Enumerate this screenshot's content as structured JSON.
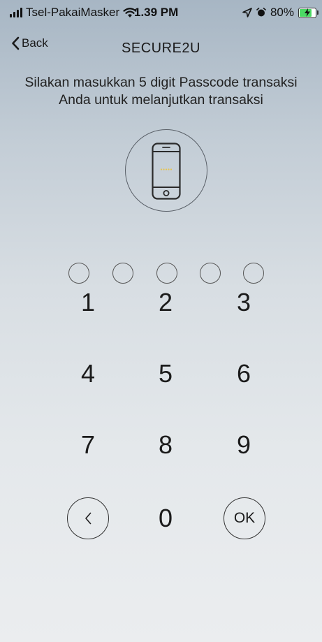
{
  "status_bar": {
    "carrier": "Tsel-PakaiMasker",
    "time": "1.39 PM",
    "battery": "80%",
    "battery_level": 0.8,
    "icons": [
      "signal-icon",
      "wifi-icon",
      "location-icon",
      "alarm-icon",
      "battery-icon",
      "charging-bolt-icon"
    ]
  },
  "nav": {
    "back_label": "Back",
    "title": "SECURE2U"
  },
  "instruction": {
    "line1": "Silakan masukkan 5 digit Passcode transaksi",
    "line2": "Anda untuk melanjutkan transaksi"
  },
  "passcode": {
    "length": 5,
    "entered": 0
  },
  "keypad": {
    "keys": [
      "1",
      "2",
      "3",
      "4",
      "5",
      "6",
      "7",
      "8",
      "9",
      "0"
    ],
    "ok_label": "OK",
    "backspace_icon": "chevron-left-icon"
  },
  "colors": {
    "battery_fill": "#4cd964",
    "phone_dots": "#e8c54a"
  }
}
